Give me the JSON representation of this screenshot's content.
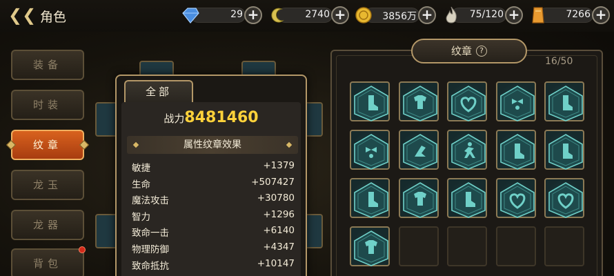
{
  "header": {
    "back_icon": "back-arrow-icon",
    "title": "角色"
  },
  "currencies": [
    {
      "icon": "diamond-icon",
      "amount": "29",
      "color": "#4a8ee0"
    },
    {
      "icon": "crescent-icon",
      "amount": "2740",
      "color": "#d8c050"
    },
    {
      "icon": "gold-coin-icon",
      "amount": "3856万",
      "color": "#e8b830"
    },
    {
      "icon": "flame-icon",
      "amount": "75/120",
      "color": "#d8d2c0"
    },
    {
      "icon": "gold-bar-icon",
      "amount": "7266",
      "color": "#e89a30"
    }
  ],
  "sidebar": {
    "items": [
      {
        "label": "装备",
        "active": false
      },
      {
        "label": "时装",
        "active": false
      },
      {
        "label": "纹章",
        "active": true
      },
      {
        "label": "龙玉",
        "active": false
      },
      {
        "label": "龙器",
        "active": false
      },
      {
        "label": "背包",
        "active": false,
        "badge": true
      }
    ]
  },
  "modal": {
    "tab_label": "全部",
    "power_label": "战力",
    "power_value": "8481460",
    "section_title": "属性纹章效果",
    "stats": [
      {
        "name": "敏捷",
        "value": "+1379"
      },
      {
        "name": "生命",
        "value": "+507427"
      },
      {
        "name": "魔法攻击",
        "value": "+30780"
      },
      {
        "name": "智力",
        "value": "+1296"
      },
      {
        "name": "致命一击",
        "value": "+6140"
      },
      {
        "name": "物理防御",
        "value": "+4347"
      },
      {
        "name": "致命抵抗",
        "value": "+10147"
      }
    ]
  },
  "emblem_panel": {
    "title": "纹章",
    "help_icon": "question-icon",
    "count": "16/50",
    "accent": "#6fd0c8",
    "slots": [
      "boot",
      "shirt",
      "heart",
      "bowtie",
      "boot",
      "bowtie",
      "sword-arm",
      "runner",
      "boot",
      "boot",
      "boot",
      "shirt",
      "boot",
      "heart",
      "heart",
      "shirt",
      "",
      "",
      "",
      ""
    ]
  }
}
